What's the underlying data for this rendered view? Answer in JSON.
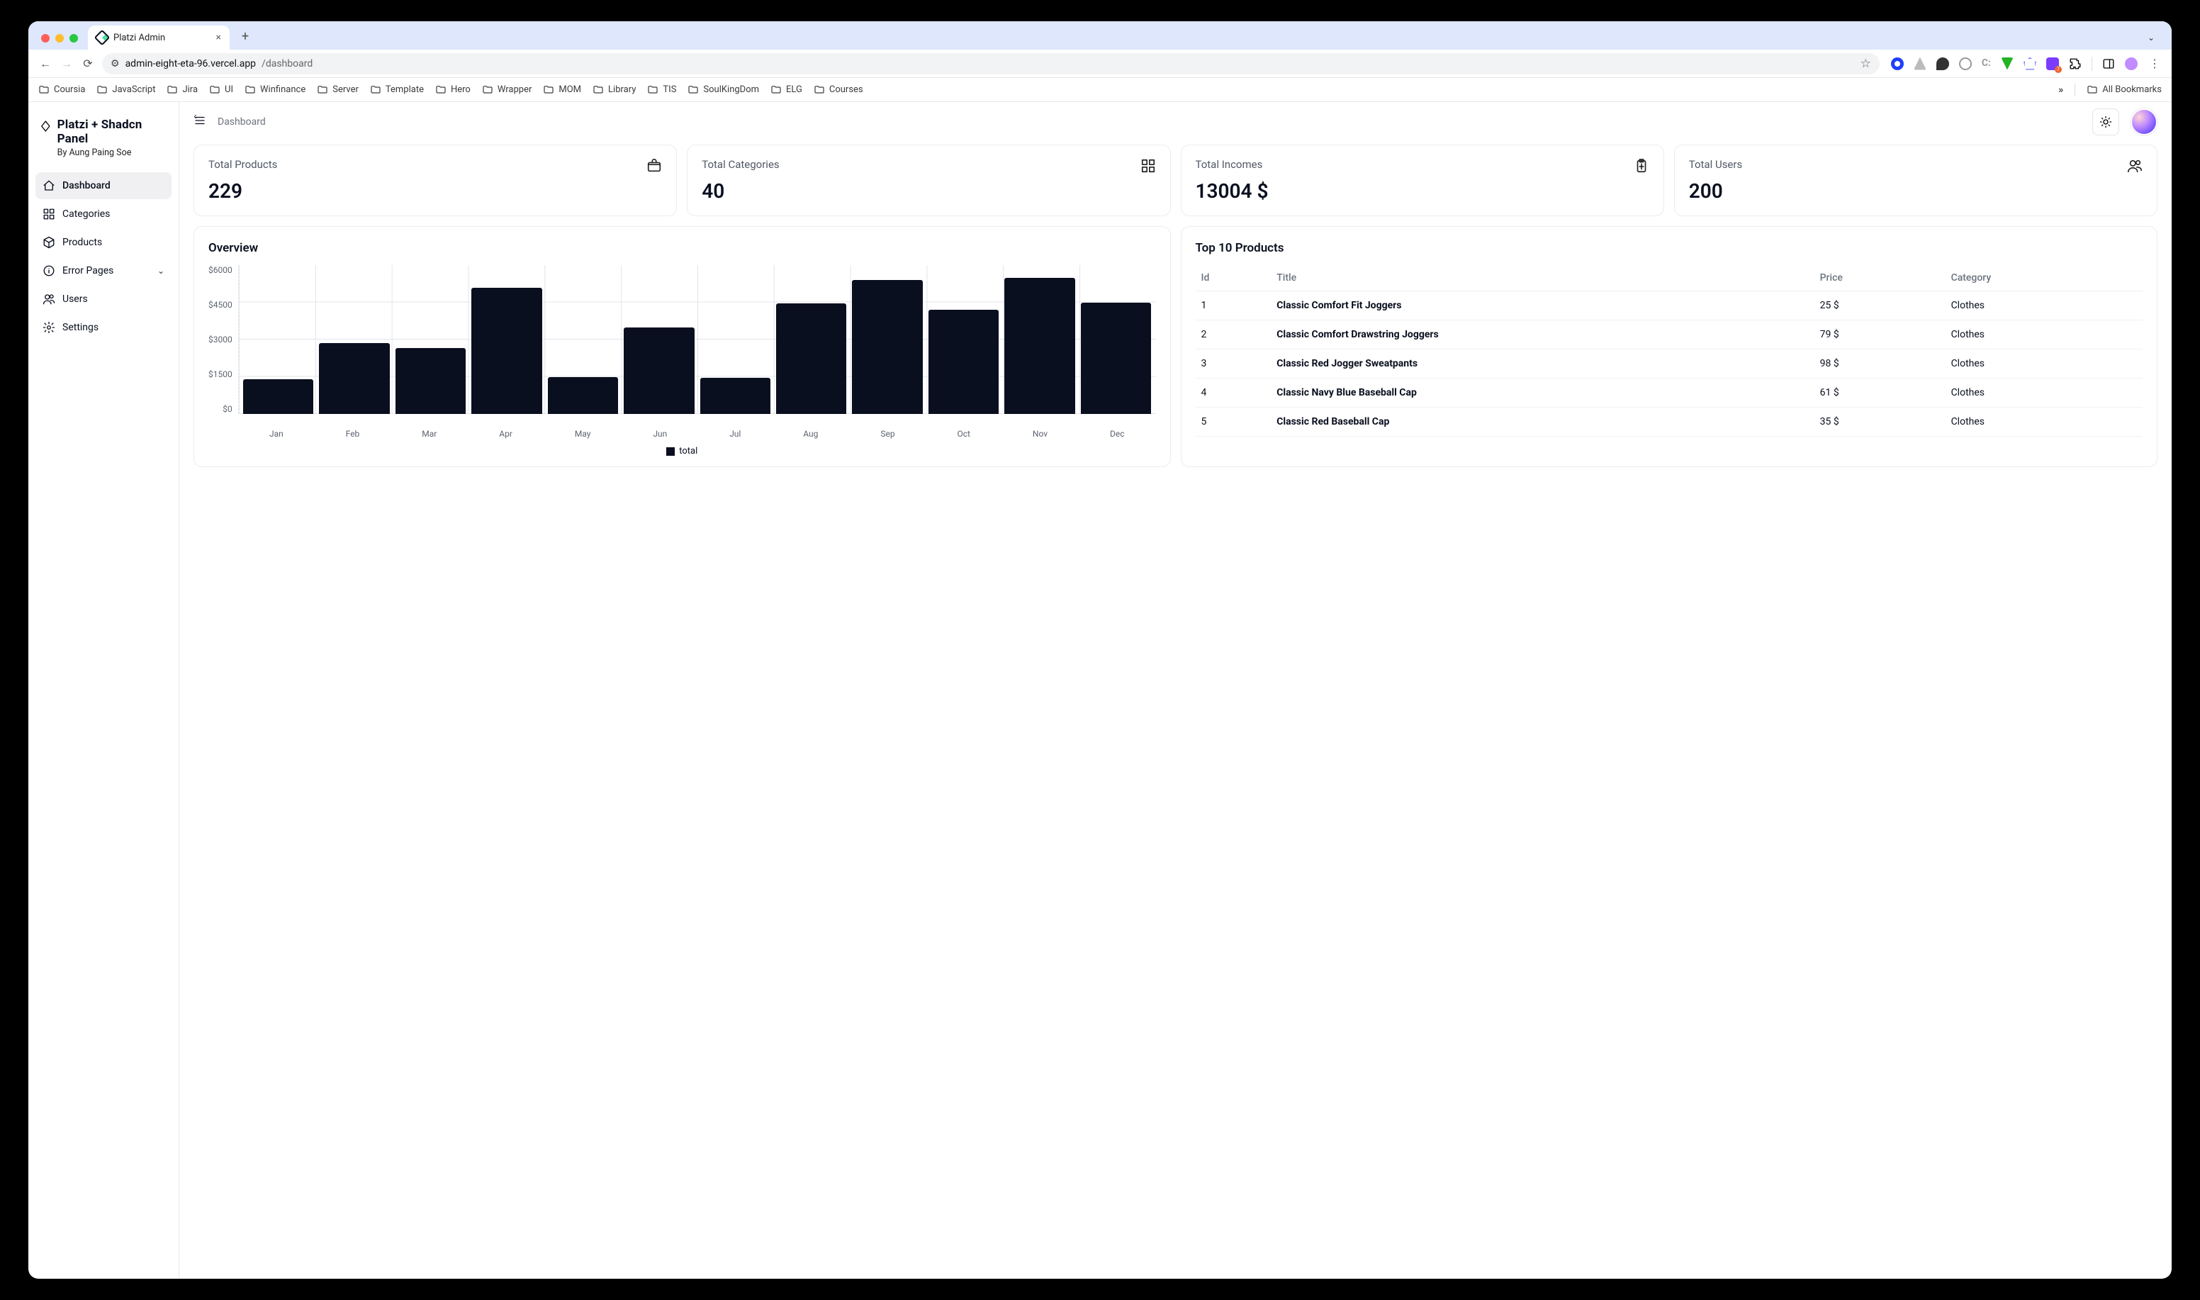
{
  "browser": {
    "tab_title": "Platzi Admin",
    "url_host": "admin-eight-eta-96.vercel.app",
    "url_path": "/dashboard",
    "bookmarks": [
      "Coursia",
      "JavaScript",
      "Jira",
      "UI",
      "Winfinance",
      "Server",
      "Template",
      "Hero",
      "Wrapper",
      "MOM",
      "Library",
      "TIS",
      "SoulKingDom",
      "ELG",
      "Courses"
    ],
    "all_bookmarks_label": "All Bookmarks"
  },
  "sidebar": {
    "title": "Platzi + Shadcn Panel",
    "subtitle": "By Aung Paing Soe",
    "items": [
      {
        "label": "Dashboard",
        "icon": "home",
        "active": true
      },
      {
        "label": "Categories",
        "icon": "grid"
      },
      {
        "label": "Products",
        "icon": "cube"
      },
      {
        "label": "Error Pages",
        "icon": "info",
        "chev": true
      },
      {
        "label": "Users",
        "icon": "users"
      },
      {
        "label": "Settings",
        "icon": "gear"
      }
    ]
  },
  "header": {
    "breadcrumb": "Dashboard"
  },
  "stats": [
    {
      "label": "Total Products",
      "value": "229",
      "icon": "package"
    },
    {
      "label": "Total Categories",
      "value": "40",
      "icon": "grid"
    },
    {
      "label": "Total Incomes",
      "value": "13004 $",
      "icon": "clipboard"
    },
    {
      "label": "Total Users",
      "value": "200",
      "icon": "users"
    }
  ],
  "overview": {
    "title": "Overview",
    "legend_label": "total"
  },
  "top_products": {
    "title": "Top 10 Products",
    "columns": [
      "Id",
      "Title",
      "Price",
      "Category"
    ],
    "rows": [
      {
        "id": "1",
        "title": "Classic Comfort Fit Joggers",
        "price": "25 $",
        "category": "Clothes"
      },
      {
        "id": "2",
        "title": "Classic Comfort Drawstring Joggers",
        "price": "79 $",
        "category": "Clothes"
      },
      {
        "id": "3",
        "title": "Classic Red Jogger Sweatpants",
        "price": "98 $",
        "category": "Clothes"
      },
      {
        "id": "4",
        "title": "Classic Navy Blue Baseball Cap",
        "price": "61 $",
        "category": "Clothes"
      },
      {
        "id": "5",
        "title": "Classic Red Baseball Cap",
        "price": "35 $",
        "category": "Clothes"
      }
    ]
  },
  "chart_data": {
    "type": "bar",
    "categories": [
      "Jan",
      "Feb",
      "Mar",
      "Apr",
      "May",
      "Jun",
      "Jul",
      "Aug",
      "Sep",
      "Oct",
      "Nov",
      "Dec"
    ],
    "values": [
      1400,
      2850,
      2650,
      5100,
      1500,
      3500,
      1450,
      4450,
      5400,
      4200,
      5500,
      4500
    ],
    "series_name": "total",
    "title": "Overview",
    "xlabel": "",
    "ylabel": "",
    "ylim": [
      0,
      6000
    ],
    "yticks": [
      0,
      1500,
      3000,
      4500,
      6000
    ],
    "ytick_labels": [
      "$0",
      "$1500",
      "$3000",
      "$4500",
      "$6000"
    ]
  }
}
